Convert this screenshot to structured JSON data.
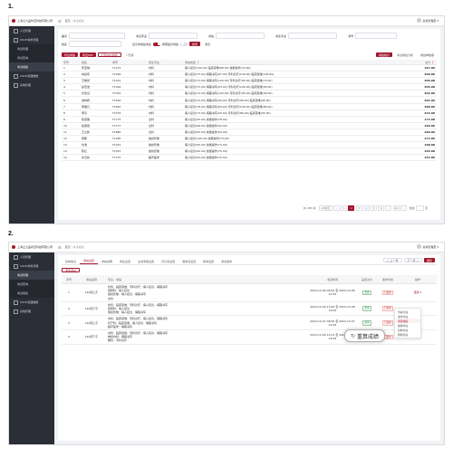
{
  "steps": [
    "1.",
    "2."
  ],
  "app": {
    "logo_text": "上海之九品时空科技有限公司",
    "menu_icon": "menu-icon",
    "user_name": "总考管理员 ▾",
    "sidebar": [
      {
        "label": "人员管理",
        "icon": "user-icon"
      },
      {
        "label": "OSCE考务管理",
        "icon": "grid-icon"
      },
      {
        "label": "考试管理",
        "icon": ""
      },
      {
        "label": "考试查询",
        "icon": ""
      },
      {
        "label": "考试成绩",
        "icon": ""
      },
      {
        "label": "OSCE基础数据",
        "icon": "database-icon"
      },
      {
        "label": "系统管理",
        "icon": "gear-icon"
      }
    ]
  },
  "screen1": {
    "breadcrumb": {
      "home": "首页",
      "current": "考试成绩"
    },
    "filters": {
      "row1": [
        "届次",
        "考试专业",
        "考站",
        "考生专业",
        "考号"
      ],
      "name_label": "姓名",
      "toggle_label": "显示未成绩考生",
      "toggle2_label": "按照提示成绩",
      "search_btn": "搜索",
      "reset_btn": "重置"
    },
    "actions": {
      "export_score": "导出成绩",
      "export_pdf": "导出PDF",
      "print_pdf": "打印PDF成绩",
      "checkbox_label": "已核",
      "right_primary": "成绩统计",
      "right_link1": "考试成绩分析",
      "right_link2": "成绩单数据"
    },
    "table": {
      "headers": [
        "序号",
        "姓名",
        "考号",
        "考生专业",
        "考站成绩 ❗",
        "总分 ❗"
      ],
      "rows": [
        [
          "1",
          "宋宝琳",
          "T1472",
          "内科",
          "病人接诊(100.00) 临床思维(88.00) 技能操作(70.00)",
          "167.00"
        ],
        [
          "2",
          "林嘉伟",
          "T1464",
          "内科",
          "病人接诊(75.00) 病程书写(87.00) 专科诊疗(100.00) 临床思维(100.00)",
          "409.00"
        ],
        [
          "3",
          "王皓然",
          "T1451",
          "内科",
          "病人接诊(73.00) 病程书写(100.00) 专科诊疗(95.00) 临床思维(73.00)",
          "406.00"
        ],
        [
          "4",
          "赵宏发",
          "T1404",
          "内科",
          "病人接诊(75.00) 病程书写(93.00) 专科诊疗(100.00) 临床思维(95.00)",
          "405.00"
        ],
        [
          "5",
          "孙志远",
          "T1301",
          "内科",
          "病人接诊(74.00) 病程书写(100.00) 专科诊疗(95.00) 临床思维(99.00)",
          "402.00"
        ],
        [
          "6",
          "谢春妍",
          "T1502",
          "内科",
          "病人接诊(72.00) 病程书写(99.00) 专科诊疗(98.00) 临床思维(95.00)",
          "401.00"
        ],
        [
          "7",
          "黄雅凡",
          "T1667",
          "内科",
          "病人接诊(78.00) 病程书写(84.00) 专科诊疗(100.00) 临床思维(86.00)",
          "388.00"
        ],
        [
          "8",
          "李丹",
          "T1576",
          "内科",
          "病人接诊(73.00) 病程书写(93.00) 专科诊疗(86.00) 临床思维(95.00)",
          "443.00"
        ],
        [
          "9",
          "陈思雅",
          "T1775",
          "全科",
          "病人接诊(95.00) 技能操作(78.00)",
          "173.00"
        ],
        [
          "10",
          "赵丽丽",
          "T1777",
          "全科",
          "病人接诊(98.00) 技能操作(92.00)",
          "190.00"
        ],
        [
          "11",
          "王立新",
          "T1880",
          "全科",
          "病人接诊(95.00) 技能操作(94.00)",
          "189.00"
        ],
        [
          "12",
          "黄鹏",
          "T1465",
          "放射影像",
          "病人接诊(100.00) 技能操作(74.00)",
          "174.00"
        ],
        [
          "13",
          "刘浩",
          "T1415",
          "放射影像",
          "病人接诊(95.00) 技能操作(73.00)",
          "168.00"
        ],
        [
          "14",
          "陈红",
          "T1557",
          "放射影像",
          "病人接诊(90.00) 技能操作(75.00)",
          "165.00"
        ],
        [
          "15",
          "余玉婷",
          "T1707",
          "超声医学",
          "病人接诊(84.00) 技能操作(70.00)",
          "154.00"
        ]
      ]
    },
    "pagination": {
      "total": "共 283 条",
      "page_size": "10条/页",
      "pages": [
        "1",
        "2",
        "3",
        "4",
        "5",
        "6",
        "...",
        "29"
      ],
      "active_page": "2",
      "goto": "前往",
      "page_unit": "页"
    }
  },
  "screen2": {
    "breadcrumb": {
      "home": "首页",
      "current": "考试成绩"
    },
    "tabs": [
      "基本信息",
      "考站设置",
      "考站说明",
      "考生设置",
      "主考考官设置",
      "评分表设置",
      "准考证设置",
      "排考设置",
      "考试发布"
    ],
    "active_tab": "考站设置",
    "add_btn": "添加考站",
    "right_btns": [
      "← 上一步",
      "下一步 →",
      "保存"
    ],
    "table": {
      "headers": [
        "序号",
        "考站名称",
        "专业、考站",
        "考试时间",
        "是否允许",
        "发布状态",
        "操作"
      ],
      "rows": [
        {
          "no": "1",
          "name": "120床上午",
          "detail": [
            "外科：临床思维、专科诊疗、病人接诊、病程书写",
            "麻醉科：病人接诊",
            "放射影像：病人接诊、病程书写",
            "全科"
          ],
          "time": "",
          "allow": "允许",
          "status": "已发布",
          "op": "更多 ▾"
        },
        {
          "no": "2",
          "name": "120床下午",
          "detail": [
            "外科：临床思维、专科诊疗、病人接诊、病程书写",
            "麻醉科：病人接诊",
            "放射影像：病人接诊、病程书写"
          ],
          "time": "2024-12-06 13:00 至 2024-12-06 16:00",
          "allow": "允许",
          "status": "已发布",
          "op": ""
        },
        {
          "no": "3",
          "name": "120床上午",
          "detail": [
            "内科：临床思维、专科诊疗、病人接诊、病程书写",
            "妇产科：临床思维、病人接诊、病程书写",
            "超声医学：病程书写"
          ],
          "time": "2024-12-07 08:00 至 2024-12-07 12:00",
          "allow": "允许",
          "status": "已发布",
          "op": ""
        },
        {
          "no": "4",
          "name": "120床下午",
          "detail": [
            "内科：临床思维、专科诊疗、病人接诊、病程书写",
            "神经内科：病程书写",
            "眼科：专科诊疗"
          ],
          "time": "2024-12-06 12:01 至 2024-12-06 16:00",
          "allow": "允许",
          "status": "已发布",
          "op": ""
        }
      ],
      "row1_time": "2024-12-06 08:00 至 2024-12-06 12:00"
    },
    "dropdown": [
      "查看考站",
      "发布考站",
      "重算成绩",
      "撤销考站",
      "复制考站",
      "删除考站"
    ],
    "dropdown_highlight": "重算成绩",
    "callout": "重算成绩",
    "callout_icon": "refresh-icon"
  }
}
